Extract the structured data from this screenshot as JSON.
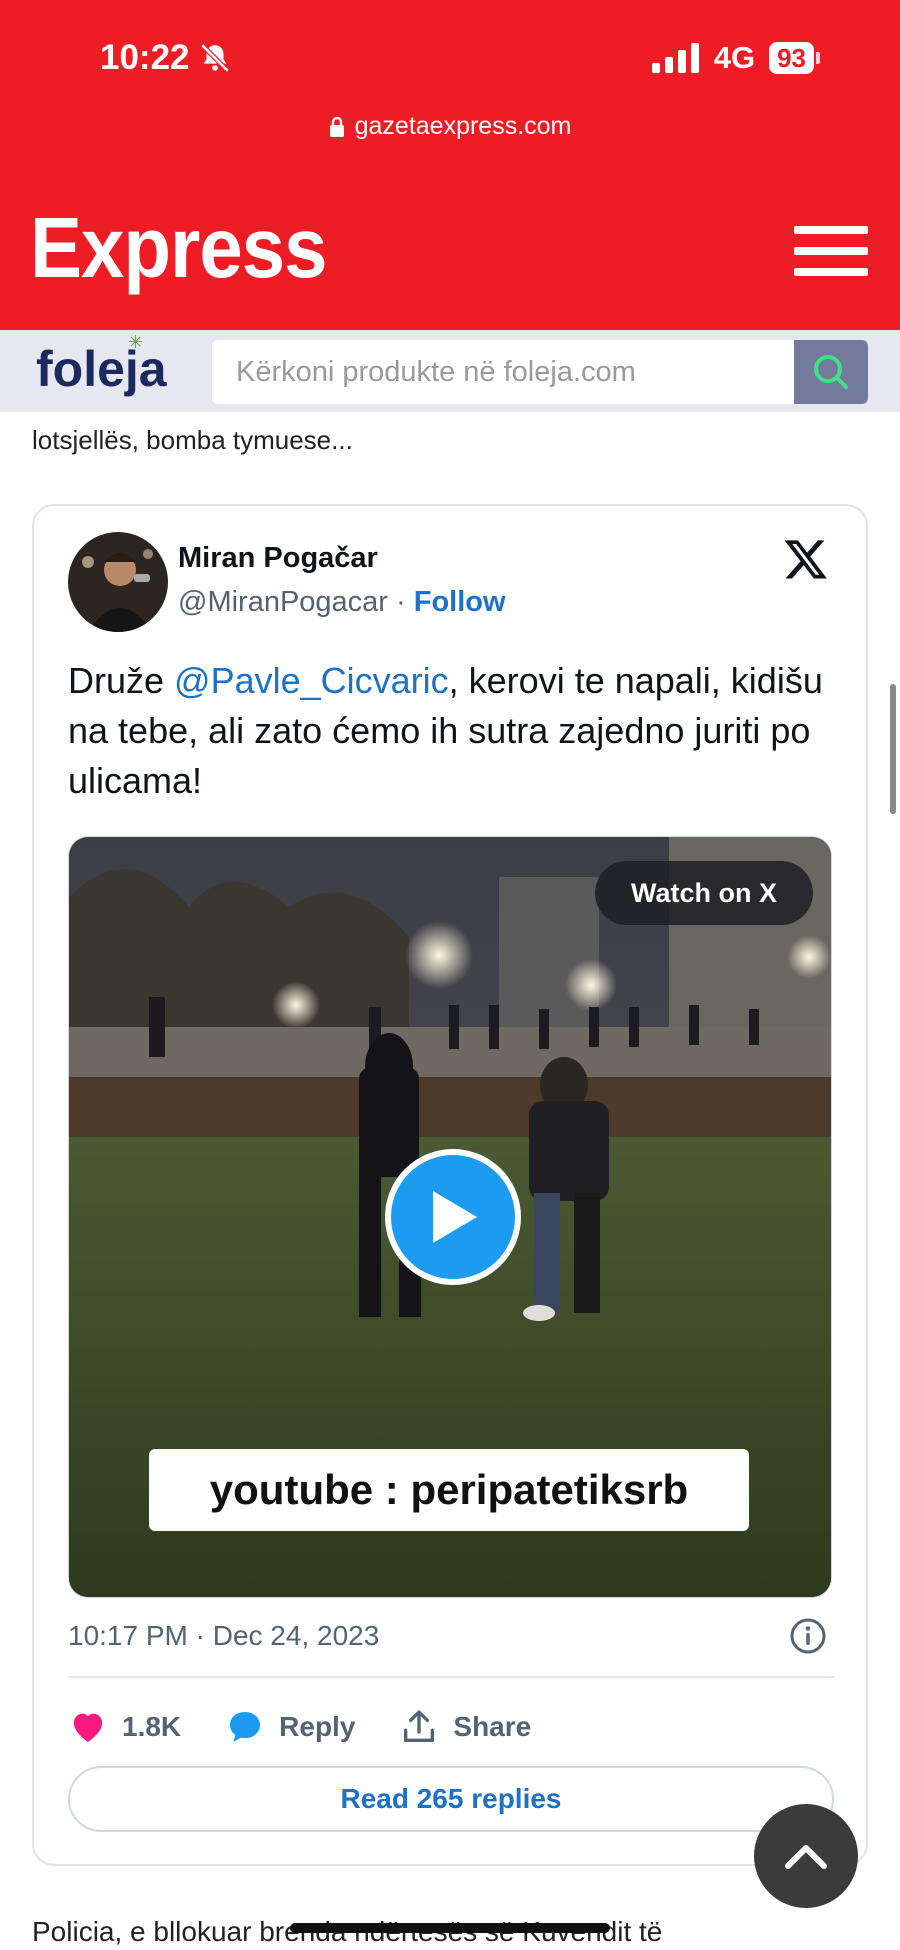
{
  "status_bar": {
    "time": "10:22",
    "network": "4G",
    "battery": "93"
  },
  "browser": {
    "url": "gazetaexpress.com"
  },
  "site": {
    "logo": "Express"
  },
  "foleja": {
    "logo": "foleja",
    "search_placeholder": "Kërkoni produkte në foleja.com"
  },
  "article": {
    "snippet_top": "lotsjellës, bomba tymuese...",
    "snippet_bottom": "Policia, e bllokuar brenda ndërtesës së Kuvendit të"
  },
  "tweet": {
    "author_name": "Miran Pogačar",
    "handle": "@MiranPogacar",
    "separator": " · ",
    "follow_label": "Follow",
    "text_prefix": "Druže ",
    "mention": "@Pavle_Cicvaric",
    "text_suffix": ", kerovi te napali, kidišu na tebe, ali zato ćemo ih sutra zajedno juriti po ulicama!",
    "media": {
      "watch_label": "Watch on X",
      "caption": "youtube : peripatetiksrb"
    },
    "timestamp": "10:17 PM · Dec 24, 2023",
    "likes": "1.8K",
    "reply_label": "Reply",
    "share_label": "Share",
    "read_replies_label": "Read 265 replies"
  },
  "colors": {
    "brand_red": "#ee1c25",
    "link_blue": "#1d72c8",
    "play_blue": "#1d9bf0",
    "like_pink": "#f91880"
  },
  "icons": [
    "bell-muted-icon",
    "signal-icon",
    "lock-icon",
    "hamburger-icon",
    "search-icon",
    "x-logo-icon",
    "play-icon",
    "info-icon",
    "heart-icon",
    "reply-bubble-icon",
    "share-icon",
    "chevron-up-icon"
  ]
}
